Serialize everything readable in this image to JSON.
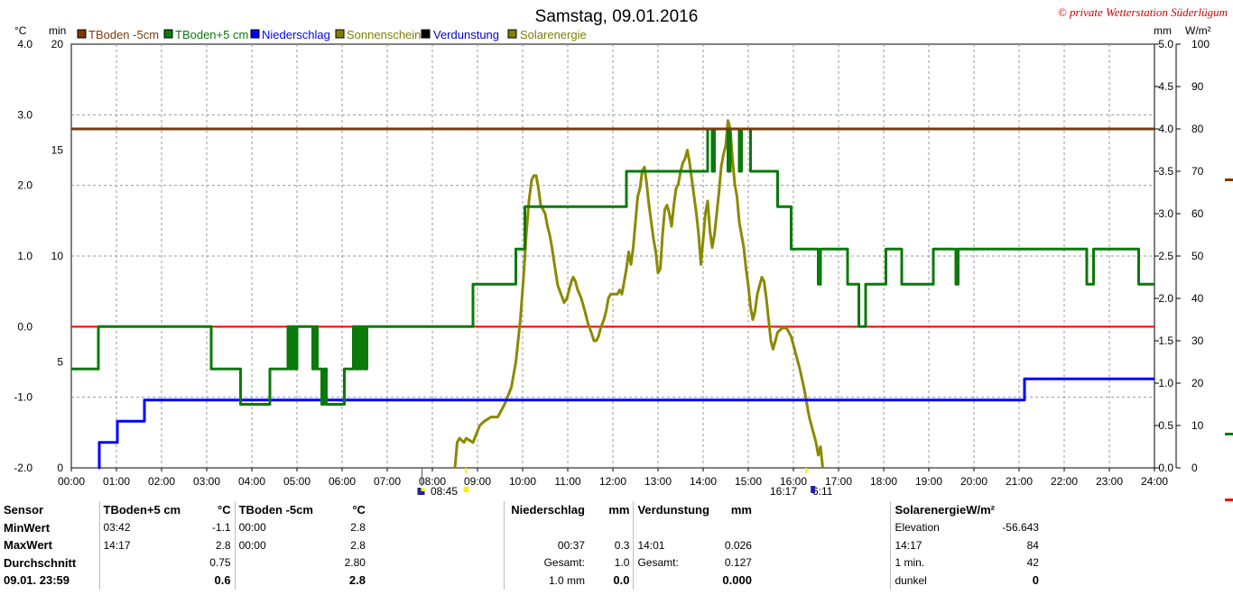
{
  "title": "Samstag, 09.01.2016",
  "copyright": "© private Wetterstation Süderlügum",
  "colors": {
    "tboden_minus5": "#7b3a0a",
    "tboden_plus5": "#0a7a0a",
    "niederschlag": "#0000ff",
    "sonnenschein": "#7f7f00",
    "verdunstung": "#000000",
    "solarenergie": "#8a8a00",
    "zero_line": "#ff0000"
  },
  "legend": [
    {
      "label": "TBoden -5cm",
      "color": "#7b3a0a"
    },
    {
      "label": "TBoden+5 cm",
      "color": "#0a7a0a"
    },
    {
      "label": "Niederschlag",
      "color": "#0000ff"
    },
    {
      "label": "Sonnenschein",
      "color": "#7f7f00"
    },
    {
      "label": "Verdunstung",
      "color": "#000000"
    },
    {
      "label": "Solarenergie",
      "color": "#7f7f00"
    }
  ],
  "axes": {
    "left_unit_celsius": "°C",
    "left_unit_min": "min",
    "right_unit_mm": "mm",
    "right_unit_wm2": "W/m²",
    "x_ticks": [
      "00:00",
      "01:00",
      "02:00",
      "03:00",
      "04:00",
      "05:00",
      "06:00",
      "07:00",
      "08:00",
      "09:00",
      "10:00",
      "11:00",
      "12:00",
      "13:00",
      "14:00",
      "15:00",
      "16:00",
      "17:00",
      "18:00",
      "19:00",
      "20:00",
      "21:00",
      "22:00",
      "23:00",
      "24:00"
    ],
    "celsius_ticks": [
      "4.0",
      "3.0",
      "2.0",
      "1.0",
      "0.0",
      "-1.0",
      "-2.0"
    ],
    "min_ticks": [
      "20",
      "15",
      "10",
      "5",
      "0"
    ],
    "mm_ticks": [
      "5.0",
      "4.5",
      "4.0",
      "3.5",
      "3.0",
      "2.5",
      "2.0",
      "1.5",
      "1.0",
      "0.5",
      "0.0"
    ],
    "wm2_ticks": [
      "100",
      "90",
      "80",
      "70",
      "60",
      "50",
      "40",
      "30",
      "20",
      "10",
      "0"
    ],
    "sunrise": "08:45",
    "sunset": "16:17",
    "daylength": "6:11"
  },
  "chart_data": {
    "type": "line",
    "title": "Samstag, 09.01.2016",
    "x_range": [
      "00:00",
      "24:00"
    ],
    "axes_ranges": {
      "celsius": [
        -2,
        4
      ],
      "min": [
        0,
        20
      ],
      "mm": [
        0,
        5
      ],
      "wm2": [
        0,
        100
      ]
    },
    "series": [
      {
        "name": "TBoden -5cm",
        "axis": "celsius",
        "type": "step",
        "points": [
          [
            0,
            2.8
          ],
          [
            24,
            2.8
          ]
        ]
      },
      {
        "name": "TBoden+5 cm",
        "axis": "celsius",
        "type": "step",
        "points": [
          [
            0,
            -0.6
          ],
          [
            0.6,
            0
          ],
          [
            3.05,
            0
          ],
          [
            3.1,
            -0.6
          ],
          [
            3.7,
            -0.6
          ],
          [
            3.75,
            -1.1
          ],
          [
            4.35,
            -1.1
          ],
          [
            4.4,
            -0.6
          ],
          [
            4.75,
            -0.6
          ],
          [
            4.8,
            0
          ],
          [
            4.85,
            -0.6
          ],
          [
            4.9,
            0
          ],
          [
            4.95,
            -0.6
          ],
          [
            5.0,
            0
          ],
          [
            5.3,
            0
          ],
          [
            5.35,
            -0.6
          ],
          [
            5.4,
            0
          ],
          [
            5.45,
            -0.6
          ],
          [
            5.5,
            -0.6
          ],
          [
            5.55,
            -1.1
          ],
          [
            5.6,
            -0.6
          ],
          [
            5.65,
            -1.1
          ],
          [
            6.0,
            -1.1
          ],
          [
            6.05,
            -0.6
          ],
          [
            6.2,
            -0.6
          ],
          [
            6.25,
            0
          ],
          [
            6.3,
            -0.6
          ],
          [
            6.35,
            0
          ],
          [
            6.4,
            -0.6
          ],
          [
            6.45,
            0
          ],
          [
            6.5,
            -0.6
          ],
          [
            6.55,
            0
          ],
          [
            8.85,
            0
          ],
          [
            8.9,
            0.6
          ],
          [
            9.8,
            0.6
          ],
          [
            9.85,
            1.1
          ],
          [
            10.0,
            1.1
          ],
          [
            10.05,
            1.7
          ],
          [
            12.25,
            1.7
          ],
          [
            12.3,
            2.2
          ],
          [
            14.05,
            2.2
          ],
          [
            14.1,
            2.8
          ],
          [
            14.2,
            2.2
          ],
          [
            14.25,
            2.8
          ],
          [
            14.5,
            2.8
          ],
          [
            14.55,
            2.2
          ],
          [
            14.6,
            2.8
          ],
          [
            14.75,
            2.8
          ],
          [
            14.8,
            2.2
          ],
          [
            14.85,
            2.8
          ],
          [
            15.0,
            2.8
          ],
          [
            15.05,
            2.2
          ],
          [
            15.6,
            2.2
          ],
          [
            15.65,
            1.7
          ],
          [
            15.9,
            1.7
          ],
          [
            15.95,
            1.1
          ],
          [
            16.5,
            1.1
          ],
          [
            16.55,
            0.6
          ],
          [
            16.6,
            1.1
          ],
          [
            17.15,
            1.1
          ],
          [
            17.2,
            0.6
          ],
          [
            17.4,
            0.6
          ],
          [
            17.45,
            0
          ],
          [
            17.55,
            0
          ],
          [
            17.6,
            0.6
          ],
          [
            18.0,
            0.6
          ],
          [
            18.05,
            1.1
          ],
          [
            18.35,
            1.1
          ],
          [
            18.4,
            0.6
          ],
          [
            19.05,
            0.6
          ],
          [
            19.1,
            1.1
          ],
          [
            19.55,
            1.1
          ],
          [
            19.6,
            0.6
          ],
          [
            19.65,
            1.1
          ],
          [
            22.45,
            1.1
          ],
          [
            22.5,
            0.6
          ],
          [
            22.6,
            0.6
          ],
          [
            22.65,
            1.1
          ],
          [
            23.6,
            1.1
          ],
          [
            23.65,
            0.6
          ],
          [
            24,
            0.6
          ]
        ]
      },
      {
        "name": "Niederschlag",
        "axis": "mm",
        "type": "step",
        "points": [
          [
            0.6,
            0
          ],
          [
            0.62,
            0.3
          ],
          [
            1.0,
            0.3
          ],
          [
            1.02,
            0.55
          ],
          [
            1.6,
            0.55
          ],
          [
            1.62,
            0.8
          ],
          [
            21.1,
            0.8
          ],
          [
            21.12,
            1.05
          ],
          [
            24,
            1.05
          ]
        ]
      },
      {
        "name": "Solarenergie",
        "axis": "wm2",
        "type": "line",
        "points": [
          [
            8.5,
            0
          ],
          [
            8.55,
            6
          ],
          [
            8.6,
            7
          ],
          [
            8.7,
            6
          ],
          [
            8.75,
            7
          ],
          [
            8.9,
            6
          ],
          [
            9.05,
            10
          ],
          [
            9.15,
            11
          ],
          [
            9.3,
            12
          ],
          [
            9.45,
            12
          ],
          [
            9.6,
            15
          ],
          [
            9.75,
            19
          ],
          [
            9.85,
            25
          ],
          [
            9.95,
            35
          ],
          [
            10.02,
            45
          ],
          [
            10.08,
            55
          ],
          [
            10.14,
            63
          ],
          [
            10.2,
            68
          ],
          [
            10.25,
            69
          ],
          [
            10.3,
            69
          ],
          [
            10.35,
            66
          ],
          [
            10.4,
            62
          ],
          [
            10.5,
            60
          ],
          [
            10.55,
            57
          ],
          [
            10.6,
            55
          ],
          [
            10.65,
            52
          ],
          [
            10.72,
            47
          ],
          [
            10.78,
            43
          ],
          [
            10.85,
            41
          ],
          [
            10.92,
            39
          ],
          [
            10.98,
            40
          ],
          [
            11.03,
            42
          ],
          [
            11.08,
            44
          ],
          [
            11.12,
            45
          ],
          [
            11.17,
            44
          ],
          [
            11.22,
            42
          ],
          [
            11.3,
            40
          ],
          [
            11.38,
            37
          ],
          [
            11.45,
            34
          ],
          [
            11.52,
            32
          ],
          [
            11.58,
            30
          ],
          [
            11.63,
            30
          ],
          [
            11.68,
            31
          ],
          [
            11.73,
            33
          ],
          [
            11.8,
            35
          ],
          [
            11.85,
            37
          ],
          [
            11.9,
            40
          ],
          [
            11.95,
            41
          ],
          [
            12.02,
            41
          ],
          [
            12.1,
            41
          ],
          [
            12.15,
            42
          ],
          [
            12.2,
            41
          ],
          [
            12.25,
            44
          ],
          [
            12.3,
            47
          ],
          [
            12.35,
            51
          ],
          [
            12.4,
            48
          ],
          [
            12.45,
            52
          ],
          [
            12.5,
            58
          ],
          [
            12.55,
            64
          ],
          [
            12.6,
            66
          ],
          [
            12.65,
            70
          ],
          [
            12.7,
            71
          ],
          [
            12.75,
            67
          ],
          [
            12.8,
            62
          ],
          [
            12.85,
            58
          ],
          [
            12.9,
            54
          ],
          [
            12.95,
            51
          ],
          [
            13.0,
            46
          ],
          [
            13.05,
            47
          ],
          [
            13.1,
            55
          ],
          [
            13.15,
            61
          ],
          [
            13.2,
            62
          ],
          [
            13.25,
            60
          ],
          [
            13.3,
            57
          ],
          [
            13.35,
            62
          ],
          [
            13.4,
            66
          ],
          [
            13.45,
            67
          ],
          [
            13.5,
            70
          ],
          [
            13.55,
            72
          ],
          [
            13.6,
            73
          ],
          [
            13.65,
            75
          ],
          [
            13.7,
            72
          ],
          [
            13.75,
            68
          ],
          [
            13.8,
            64
          ],
          [
            13.85,
            60
          ],
          [
            13.9,
            55
          ],
          [
            13.95,
            48
          ],
          [
            14.0,
            54
          ],
          [
            14.05,
            60
          ],
          [
            14.1,
            63
          ],
          [
            14.15,
            56
          ],
          [
            14.2,
            52
          ],
          [
            14.25,
            55
          ],
          [
            14.3,
            60
          ],
          [
            14.35,
            65
          ],
          [
            14.4,
            71
          ],
          [
            14.45,
            74
          ],
          [
            14.5,
            76
          ],
          [
            14.55,
            82
          ],
          [
            14.6,
            80
          ],
          [
            14.65,
            73
          ],
          [
            14.7,
            67
          ],
          [
            14.75,
            64
          ],
          [
            14.8,
            58
          ],
          [
            14.85,
            55
          ],
          [
            14.9,
            52
          ],
          [
            14.95,
            47
          ],
          [
            15.0,
            43
          ],
          [
            15.05,
            38
          ],
          [
            15.1,
            35
          ],
          [
            15.15,
            37
          ],
          [
            15.2,
            41
          ],
          [
            15.25,
            43
          ],
          [
            15.3,
            45
          ],
          [
            15.35,
            44
          ],
          [
            15.4,
            40
          ],
          [
            15.45,
            35
          ],
          [
            15.5,
            30
          ],
          [
            15.55,
            28
          ],
          [
            15.6,
            30
          ],
          [
            15.65,
            32
          ],
          [
            15.75,
            33
          ],
          [
            15.85,
            33
          ],
          [
            15.95,
            31
          ],
          [
            16.05,
            27
          ],
          [
            16.15,
            23
          ],
          [
            16.25,
            18
          ],
          [
            16.3,
            15
          ],
          [
            16.35,
            12
          ],
          [
            16.4,
            10
          ],
          [
            16.45,
            8
          ],
          [
            16.5,
            6
          ],
          [
            16.55,
            3
          ],
          [
            16.6,
            5
          ],
          [
            16.65,
            0
          ]
        ]
      }
    ]
  },
  "stats": {
    "rows": [
      [
        "Sensor",
        "TBoden+5 cm",
        "°C",
        "TBoden -5cm",
        "°C",
        "",
        "Niederschlag",
        "mm",
        "Verdunstung",
        "mm",
        "",
        "SolarenergieW/m²",
        ""
      ],
      [
        "MinWert",
        "03:42",
        "-1.1",
        "00:00",
        "2.8",
        "",
        "",
        "",
        "",
        "",
        "",
        "Elevation",
        "-56.643"
      ],
      [
        "MaxWert",
        "14:17",
        "2.8",
        "00:00",
        "2.8",
        "",
        "00:37",
        "0.3",
        "14:01",
        "0.026",
        "",
        "14:17",
        "84"
      ],
      [
        "Durchschnitt",
        "",
        "0.75",
        "",
        "2.80",
        "",
        "Gesamt:",
        "1.0",
        "Gesamt:",
        "0.127",
        "",
        "1 min.",
        "42"
      ],
      [
        "09.01. 23:59",
        "",
        "0.6",
        "",
        "2.8",
        "",
        "1.0 mm",
        "0.0",
        "",
        "0.000",
        "",
        "dunkel",
        "0"
      ]
    ]
  }
}
